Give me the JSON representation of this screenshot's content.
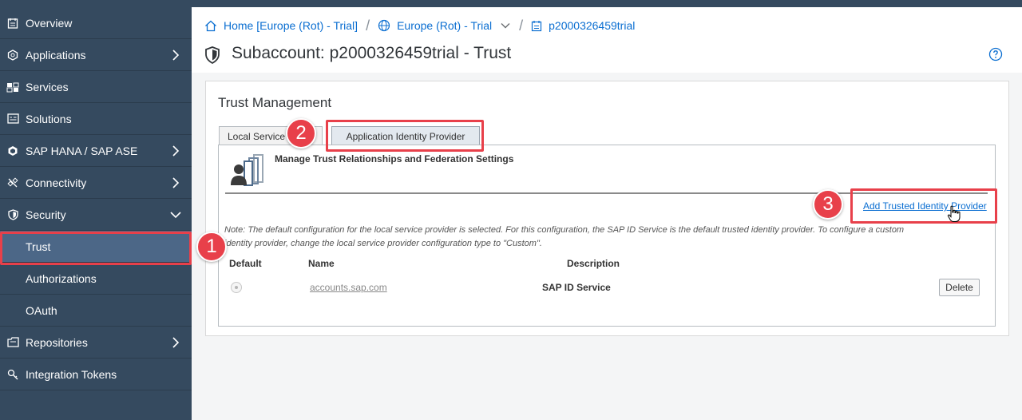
{
  "sidebar": {
    "items": [
      {
        "label": "Overview",
        "icon": "document-icon"
      },
      {
        "label": "Applications",
        "icon": "hexagon-icon",
        "expandable": true
      },
      {
        "label": "Services",
        "icon": "services-icon"
      },
      {
        "label": "Solutions",
        "icon": "window-icon"
      },
      {
        "label": "SAP HANA / SAP ASE",
        "icon": "hana-icon",
        "expandable": true
      },
      {
        "label": "Connectivity",
        "icon": "connectivity-icon",
        "expandable": true
      },
      {
        "label": "Security",
        "icon": "shield-icon",
        "expanded": true
      },
      {
        "label": "Trust",
        "active": true
      },
      {
        "label": "Authorizations"
      },
      {
        "label": "OAuth"
      },
      {
        "label": "Repositories",
        "icon": "repository-icon",
        "expandable": true
      },
      {
        "label": "Integration Tokens",
        "icon": "key-icon"
      }
    ]
  },
  "breadcrumb": {
    "home": "Home [Europe (Rot) - Trial]",
    "region": "Europe (Rot) - Trial",
    "subaccount": "p2000326459trial"
  },
  "page": {
    "title": "Subaccount: p2000326459trial - Trust"
  },
  "trust": {
    "section_title": "Trust Management",
    "tabs": [
      "Local Service",
      "Application Identity Provider"
    ],
    "manage_title": "Manage Trust Relationships and Federation Settings",
    "add_link": "Add Trusted Identity Provider",
    "note_line1": "Note: The default configuration for the local service provider is selected. For this configuration, the SAP ID Service is the default trusted identity provider. To configure a custom",
    "note_line2": "identity provider, change the local service provider configuration type to \"Custom\".",
    "columns": [
      "Default",
      "Name",
      "Description"
    ],
    "rows": [
      {
        "name": "accounts.sap.com",
        "description": "SAP ID Service",
        "action": "Delete"
      }
    ]
  },
  "annotations": {
    "badges": [
      "1",
      "2",
      "3"
    ],
    "color": "#e8404a"
  },
  "colors": {
    "sidebar_bg": "#354a5f",
    "sidebar_active": "#4c6787",
    "link": "#0a6ed1"
  }
}
